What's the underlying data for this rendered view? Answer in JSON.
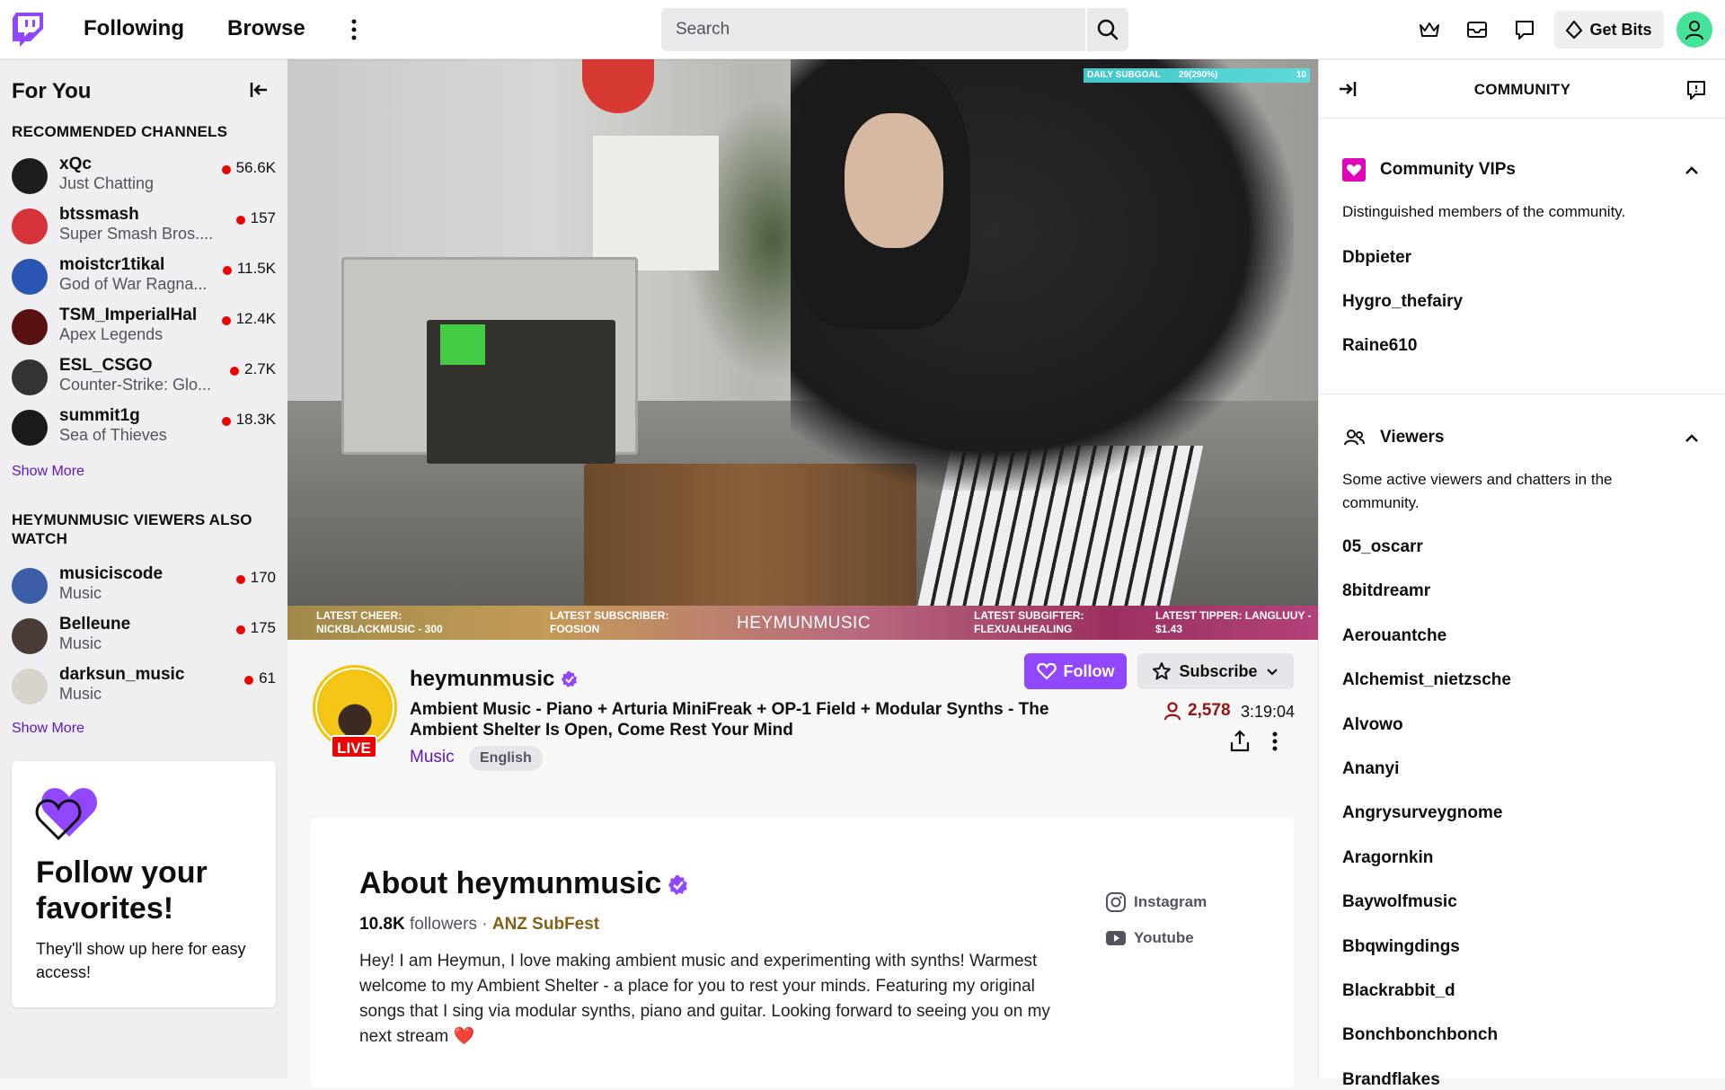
{
  "nav": {
    "following": "Following",
    "browse": "Browse",
    "search_placeholder": "Search",
    "get_bits": "Get Bits"
  },
  "sidebar": {
    "title": "For You",
    "recommended_heading": "RECOMMENDED CHANNELS",
    "recommended": [
      {
        "name": "xQc",
        "game": "Just Chatting",
        "viewers": "56.6K",
        "avatar_color": "#1d1d1f"
      },
      {
        "name": "btssmash",
        "game": "Super Smash Bros....",
        "viewers": "157",
        "avatar_color": "#d6333a"
      },
      {
        "name": "moistcr1tikal",
        "game": "God of War Ragna...",
        "viewers": "11.5K",
        "avatar_color": "#2a55b3"
      },
      {
        "name": "TSM_ImperialHal",
        "game": "Apex Legends",
        "viewers": "12.4K",
        "avatar_color": "#5a1111"
      },
      {
        "name": "ESL_CSGO",
        "game": "Counter-Strike: Glo...",
        "viewers": "2.7K",
        "avatar_color": "#333333"
      },
      {
        "name": "summit1g",
        "game": "Sea of Thieves",
        "viewers": "18.3K",
        "avatar_color": "#1a1a1a"
      }
    ],
    "show_more": "Show More",
    "also_watch_heading": "HEYMUNMUSIC VIEWERS ALSO WATCH",
    "also_watch": [
      {
        "name": "musiciscode",
        "game": "Music",
        "viewers": "170",
        "avatar_color": "#3c5ea8"
      },
      {
        "name": "Belleune",
        "game": "Music",
        "viewers": "175",
        "avatar_color": "#4a3b36"
      },
      {
        "name": "darksun_music",
        "game": "Music",
        "viewers": "61",
        "avatar_color": "#d8d4cc"
      }
    ],
    "show_more_2": "Show More",
    "promo": {
      "title": "Follow your favorites!",
      "subtitle": "They'll show up here for easy access!"
    }
  },
  "video": {
    "goal_label": "DAILY SUBGOAL",
    "goal_value": "29(290%)",
    "goal_target": "10",
    "latest_cheer_label": "LATEST CHEER:",
    "latest_cheer_value": "NICKBLACKMUSIC - 300",
    "latest_sub_label": "LATEST SUBSCRIBER:",
    "latest_sub_value": "FOOSION",
    "center": "HEYMUNMUSIC",
    "latest_gifter_label": "LATEST SUBGIFTER:",
    "latest_gifter_value": "FLEXUALHEALING",
    "latest_tipper_label": "LATEST TIPPER: LANGLUUY -",
    "latest_tipper_value": "$1.43"
  },
  "channel": {
    "name": "heymunmusic",
    "live": "LIVE",
    "title": "Ambient Music - Piano + Arturia MiniFreak + OP-1 Field + Modular Synths - The Ambient Shelter Is Open, Come Rest Your Mind",
    "category": "Music",
    "tag": "English",
    "follow": "Follow",
    "subscribe": "Subscribe",
    "viewers": "2,578",
    "uptime": "3:19:04"
  },
  "about": {
    "title": "About heymunmusic",
    "followers_count": "10.8K",
    "followers_label": "followers",
    "separator": "·",
    "team": "ANZ SubFest",
    "description": "Hey! I am Heymun, I love making ambient music and experimenting with synths! Warmest welcome to my Ambient Shelter - a place for you to rest your minds. Featuring my original songs that I sing via modular synths, piano and guitar. Looking forward to seeing you on my next stream ❤️",
    "socials": [
      {
        "label": "Instagram",
        "icon": "instagram-icon"
      },
      {
        "label": "Youtube",
        "icon": "youtube-icon"
      }
    ]
  },
  "community": {
    "title": "COMMUNITY",
    "vips_title": "Community VIPs",
    "vips_desc": "Distinguished members of the community.",
    "vips": [
      "Dbpieter",
      "Hygro_thefairy",
      "Raine610"
    ],
    "viewers_title": "Viewers",
    "viewers_desc": "Some active viewers and chatters in the community.",
    "viewers": [
      "05_oscarr",
      "8bitdreamr",
      "Aerouantche",
      "Alchemist_nietzsche",
      "Alvowo",
      "Ananyi",
      "Angrysurveygnome",
      "Aragornkin",
      "Baywolfmusic",
      "Bbqwingdings",
      "Blackrabbit_d",
      "Bonchbonchbonch",
      "Brandflakes"
    ]
  },
  "colors": {
    "brand": "#9147ff",
    "live": "#eb0400",
    "link": "#5c16c5"
  }
}
